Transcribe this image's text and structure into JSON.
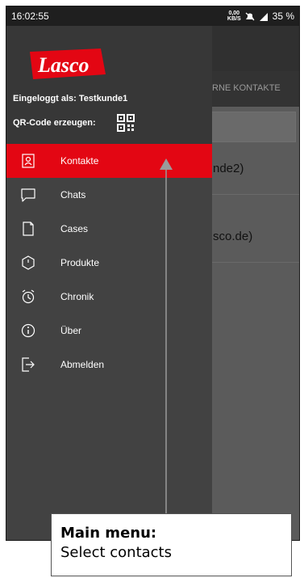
{
  "status_bar": {
    "time": "16:02:55",
    "net_speed_value": "0,00",
    "net_speed_unit": "KB/S",
    "battery": "35 %"
  },
  "background_app": {
    "tab_label": "RNE KONTAKTE",
    "rows": [
      "nde2)",
      "sco.de)"
    ]
  },
  "drawer": {
    "brand": "Lasco",
    "logged_in": "Eingeloggt als: Testkunde1",
    "qr_label": "QR-Code erzeugen:",
    "items": [
      {
        "label": "Kontakte",
        "icon": "contacts-icon",
        "active": true
      },
      {
        "label": "Chats",
        "icon": "chat-icon",
        "active": false
      },
      {
        "label": "Cases",
        "icon": "document-icon",
        "active": false
      },
      {
        "label": "Produkte",
        "icon": "product-icon",
        "active": false
      },
      {
        "label": "Chronik",
        "icon": "clock-icon",
        "active": false
      },
      {
        "label": "Über",
        "icon": "info-icon",
        "active": false
      },
      {
        "label": "Abmelden",
        "icon": "logout-icon",
        "active": false
      }
    ]
  },
  "callout": {
    "title": "Main menu:",
    "text": "Select contacts"
  },
  "colors": {
    "accent": "#e30613",
    "drawer": "#424242",
    "drawer_header": "#373737"
  }
}
